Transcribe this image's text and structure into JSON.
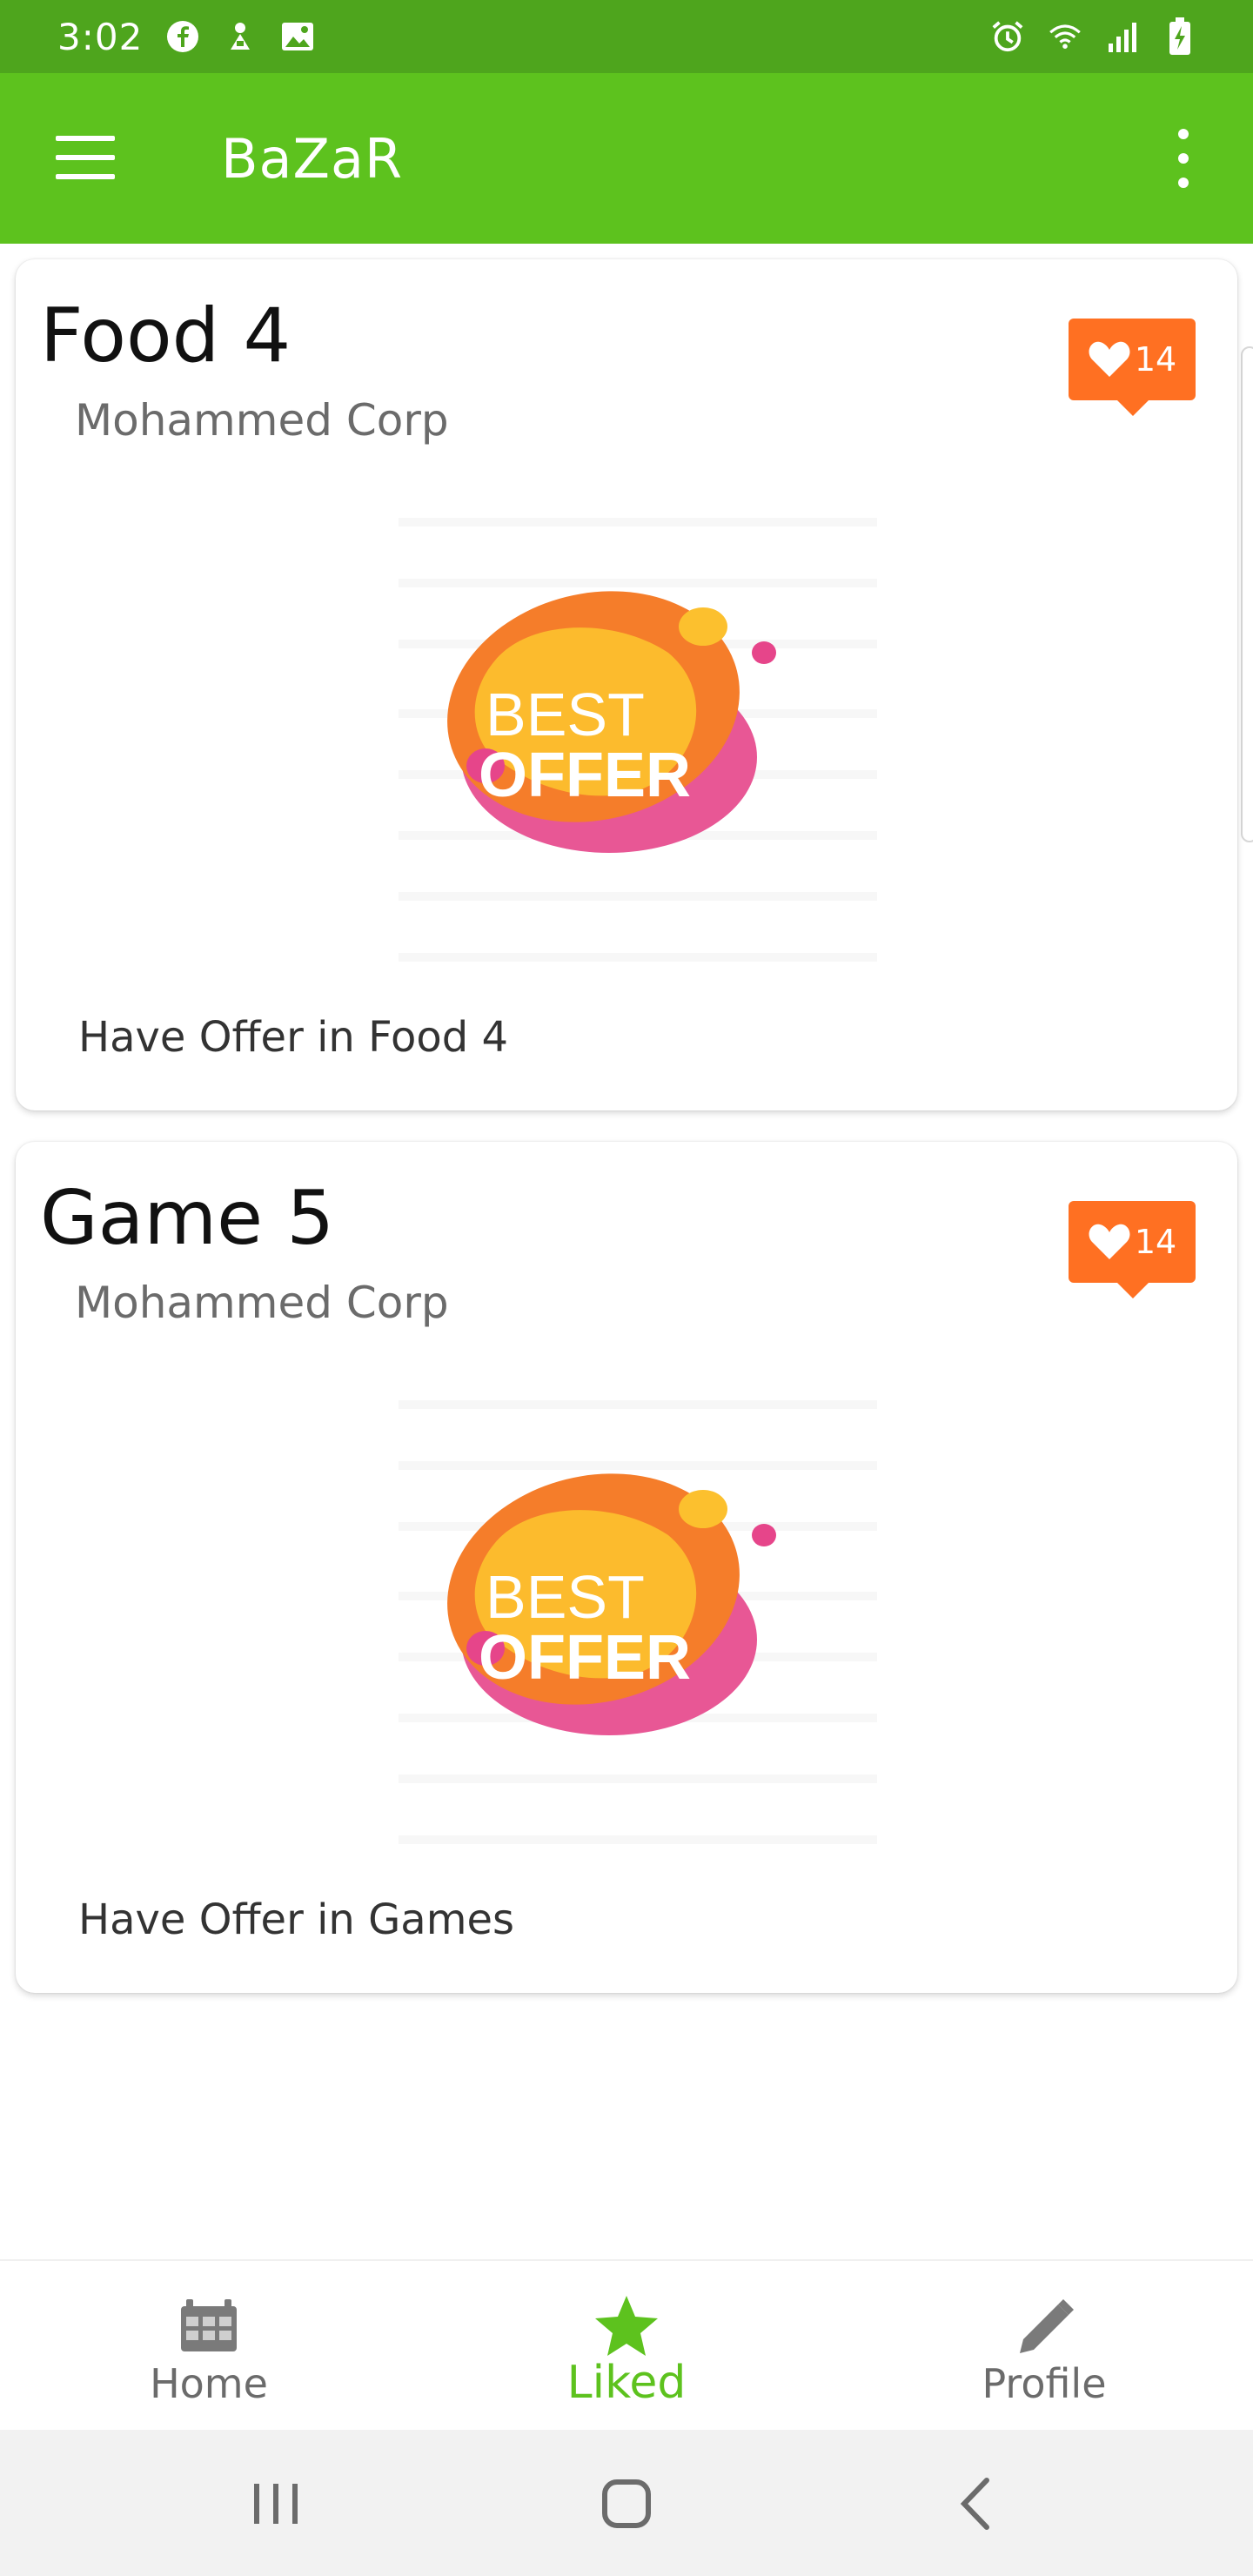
{
  "status_bar": {
    "time": "3:02",
    "icons": [
      "facebook-icon",
      "download-icon",
      "image-icon",
      "alarm-icon",
      "wifi-icon",
      "signal-icon",
      "battery-charging-icon"
    ]
  },
  "app_bar": {
    "title": "BaZaR",
    "menu_icon": "hamburger-menu-icon",
    "overflow_icon": "more-vert-icon"
  },
  "cards": [
    {
      "title": "Food 4",
      "company": "Mohammed Corp",
      "likes": "14",
      "image_text_top": "BEST",
      "image_text_bottom": "OFFER",
      "description": "Have Offer in Food 4"
    },
    {
      "title": "Game 5",
      "company": "Mohammed Corp",
      "likes": "14",
      "image_text_top": "BEST",
      "image_text_bottom": "OFFER",
      "description": "Have Offer in Games"
    }
  ],
  "bottom_nav": {
    "items": [
      {
        "label": "Home",
        "icon": "home-grid-icon"
      },
      {
        "label": "Liked",
        "icon": "star-icon"
      },
      {
        "label": "Profile",
        "icon": "pencil-icon"
      }
    ],
    "active_index": 1
  },
  "colors": {
    "status_bar": "#4ea51d",
    "app_bar": "#5dc21e",
    "like_badge": "#ff7022",
    "active_nav": "#5dc21e"
  }
}
